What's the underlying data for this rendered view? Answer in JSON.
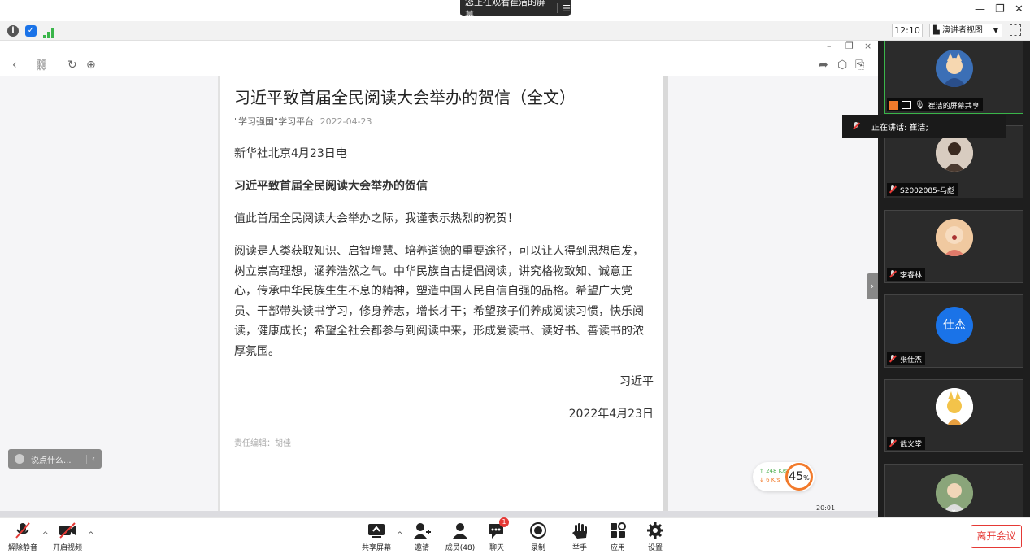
{
  "window": {
    "share_banner": "您正在观看崔洁的屏幕",
    "minimize": "—",
    "restore": "❐",
    "close": "✕"
  },
  "infobar": {
    "clock": "12:10",
    "view_mode": "演讲者视图"
  },
  "article": {
    "title": "习近平致首届全民阅读大会举办的贺信（全文）",
    "source": "\"学习强国\"学习平台",
    "date": "2022-04-23",
    "dateline": "新华社北京4月23日电",
    "heading": "习近平致首届全民阅读大会举办的贺信",
    "greeting": "值此首届全民阅读大会举办之际，我谨表示热烈的祝贺！",
    "body": "阅读是人类获取知识、启智增慧、培养道德的重要途径，可以让人得到思想启发，树立崇高理想，涵养浩然之气。中华民族自古提倡阅读，讲究格物致知、诚意正心，传承中华民族生生不息的精神，塑造中国人民自信自强的品格。希望广大党员、干部带头读书学习，修身养志，增长才干；希望孩子们养成阅读习惯，快乐阅读，健康成长；希望全社会都参与到阅读中来，形成爱读书、读好书、善读书的浓厚氛围。",
    "signature": "习近平",
    "sign_date": "2022年4月23日",
    "editor": "责任编辑：胡佳"
  },
  "overlay": {
    "comment_placeholder": "说点什么...",
    "upload_speed": "248 K/s",
    "download_speed": "6  K/s",
    "cpu_percent": "45",
    "cpu_unit": "%",
    "strip_time": "20:01"
  },
  "participants": {
    "speaking_now": "正在讲话: 崔洁;",
    "tiles": [
      {
        "name": "崔洁的屏幕共享"
      },
      {
        "name": "S2002085-马彪"
      },
      {
        "name": "李睿林"
      },
      {
        "name": "张仕杰",
        "initials": "仕杰"
      },
      {
        "name": "武义堂"
      },
      {
        "name": ""
      }
    ]
  },
  "toolbar": {
    "unmute": "解除静音",
    "start_video": "开启视频",
    "share_screen": "共享屏幕",
    "invite": "邀请",
    "members": "成员(48)",
    "chat": "聊天",
    "chat_badge": "1",
    "record": "录制",
    "raise_hand": "举手",
    "apps": "应用",
    "settings": "设置",
    "leave": "离开会议"
  },
  "colors": {
    "accent_blue": "#1a73e8",
    "leave_red": "#e53935",
    "active_green": "#3ab54a"
  }
}
